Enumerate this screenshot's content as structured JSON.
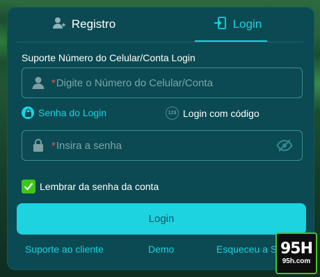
{
  "tabs": {
    "register": {
      "label": "Registro",
      "icon": "add-user-icon"
    },
    "login": {
      "label": "Login",
      "icon": "login-door-icon",
      "active": true
    }
  },
  "account": {
    "label": "Suporte Número do Celular/Conta Login",
    "required_mark": "*",
    "placeholder": "Digite o Número do Celular/Conta",
    "value": "",
    "icon": "user-icon"
  },
  "login_modes": {
    "password": {
      "label": "Senha do Login",
      "icon": "lock-icon",
      "active": true
    },
    "code": {
      "label": "Login com código",
      "icon": "code-123-icon",
      "icon_text": "123"
    }
  },
  "password": {
    "required_mark": "*",
    "placeholder": "Insira a senha",
    "value": "",
    "icon": "lock-icon",
    "toggle_icon": "eye-off-icon"
  },
  "remember": {
    "label": "Lembrar da senha da conta",
    "checked": true
  },
  "submit": {
    "label": "Login"
  },
  "footer": {
    "support": "Suporte ao cliente",
    "demo": "Demo",
    "forgot": "Esqueceu a S"
  },
  "watermark": {
    "big": "95H",
    "small": "95h.com"
  },
  "colors": {
    "panel": "#0b4a52",
    "accent": "#19d3e0",
    "button": "#1cd3df",
    "checkbox": "#3ec61f",
    "required": "#ff4a4a"
  }
}
